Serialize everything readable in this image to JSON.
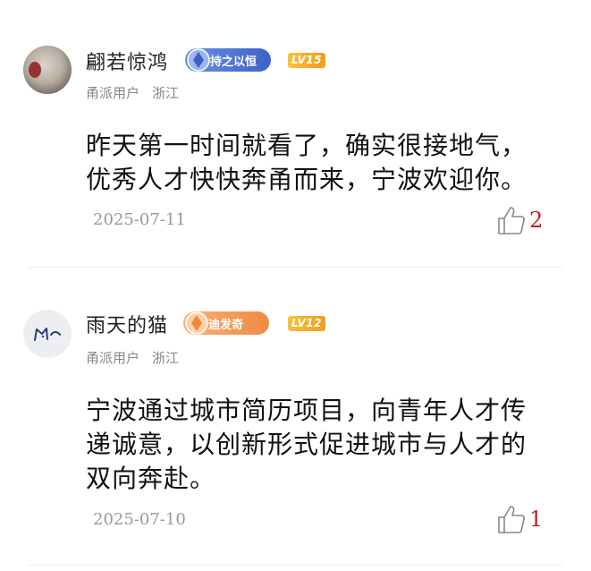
{
  "comments": [
    {
      "username": "翩若惊鸿",
      "badge": "持之以恒",
      "badge_color": "#4a6fd4",
      "level": "LV15",
      "user_type": "甬派用户",
      "location": "浙江",
      "content_lines": [
        "昨天第一时间就看了，确实很接地气，",
        "优秀人才快快奔甬而来，宁波欢迎你。"
      ],
      "date": "2025-07-11",
      "likes": "2",
      "avatar_icon": "avatar-painting-icon"
    },
    {
      "username": "雨天的猫",
      "badge": "迪发奇",
      "badge_color": "#f0904a",
      "level": "LV12",
      "user_type": "甬派用户",
      "location": "浙江",
      "content_lines": [
        "宁波通过城市简历项目，向青年人才传",
        "递诚意，以创新形式促进城市与人才的",
        "双向奔赴。"
      ],
      "date": "2025-07-10",
      "likes": "1",
      "avatar_icon": "cat-face-sketch-icon"
    }
  ],
  "like_icon": "thumbs-up-icon",
  "like_count_color": "#c61c1c"
}
